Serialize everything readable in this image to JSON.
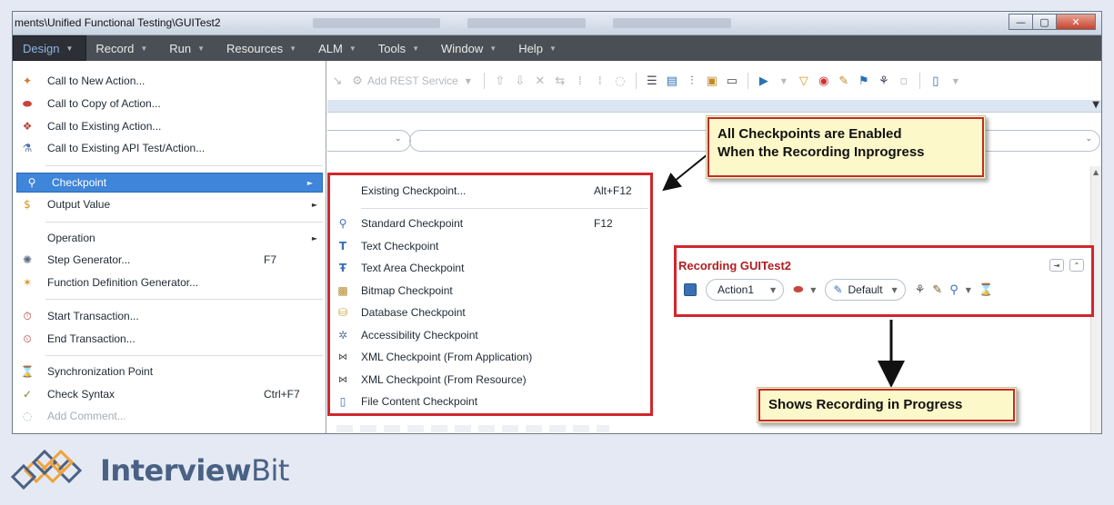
{
  "window": {
    "title": "ments\\Unified Functional Testing\\GUITest2",
    "buttons": {
      "minimize": "—",
      "maximize": "▢",
      "close": "✕"
    }
  },
  "menubar": {
    "items": [
      {
        "label": "Design",
        "active": true
      },
      {
        "label": "Record"
      },
      {
        "label": "Run"
      },
      {
        "label": "Resources"
      },
      {
        "label": "ALM"
      },
      {
        "label": "Tools"
      },
      {
        "label": "Window"
      },
      {
        "label": "Help"
      }
    ],
    "arrow": "▼"
  },
  "toolbar": {
    "add_rest": "Add REST Service"
  },
  "design_menu": {
    "items": [
      {
        "label": "Call to New Action...",
        "icon": "new-action-icon"
      },
      {
        "label": "Call to Copy of Action...",
        "icon": "copy-action-icon"
      },
      {
        "label": "Call to Existing Action...",
        "icon": "existing-action-icon"
      },
      {
        "label": "Call to Existing API Test/Action...",
        "icon": "api-test-icon"
      },
      {
        "label": "Checkpoint",
        "icon": "checkpoint-icon",
        "submenu": "►"
      },
      {
        "label": "Output Value",
        "icon": "output-value-icon",
        "submenu": "►"
      },
      {
        "label": "Operation",
        "submenu": "►"
      },
      {
        "label": "Step Generator...",
        "icon": "step-generator-icon",
        "shortcut": "F7"
      },
      {
        "label": "Function Definition Generator...",
        "icon": "function-generator-icon"
      },
      {
        "label": "Start Transaction...",
        "icon": "start-transaction-icon"
      },
      {
        "label": "End Transaction...",
        "icon": "end-transaction-icon"
      },
      {
        "label": "Synchronization Point",
        "icon": "sync-point-icon"
      },
      {
        "label": "Check Syntax",
        "icon": "check-syntax-icon",
        "shortcut": "Ctrl+F7"
      },
      {
        "label": "Add Comment...",
        "icon": "comment-icon",
        "disabled": true
      }
    ]
  },
  "checkpoint_menu": {
    "items": [
      {
        "label": "Existing Checkpoint...",
        "shortcut": "Alt+F12"
      },
      {
        "label": "Standard Checkpoint",
        "shortcut": "F12",
        "icon": "standard-checkpoint-icon"
      },
      {
        "label": "Text Checkpoint",
        "icon": "text-checkpoint-icon"
      },
      {
        "label": "Text Area Checkpoint",
        "icon": "text-area-checkpoint-icon"
      },
      {
        "label": "Bitmap Checkpoint",
        "icon": "bitmap-checkpoint-icon"
      },
      {
        "label": "Database Checkpoint",
        "icon": "database-checkpoint-icon"
      },
      {
        "label": "Accessibility Checkpoint",
        "icon": "accessibility-checkpoint-icon"
      },
      {
        "label": "XML Checkpoint (From Application)",
        "icon": "xml-app-checkpoint-icon"
      },
      {
        "label": "XML Checkpoint (From Resource)",
        "icon": "xml-resource-checkpoint-icon"
      },
      {
        "label": "File Content Checkpoint",
        "icon": "file-content-checkpoint-icon"
      }
    ]
  },
  "recording": {
    "title": "Recording GUITest2",
    "action": "Action1",
    "mode": "Default"
  },
  "callouts": {
    "checkpoints_line1": "All Checkpoints are Enabled",
    "checkpoints_line2": "When the Recording Inprogress",
    "recording": "Shows Recording in Progress"
  },
  "logo": {
    "bold": "Interview",
    "light": "Bit"
  },
  "colors": {
    "menubar": "#4a4f55",
    "highlight": "#3f85d9",
    "annotation_red": "#d0282c",
    "callout_bg": "#fdf8c9",
    "recording_title": "#b11d20",
    "logo_blue": "#4a6184",
    "logo_orange": "#f0a33a"
  }
}
